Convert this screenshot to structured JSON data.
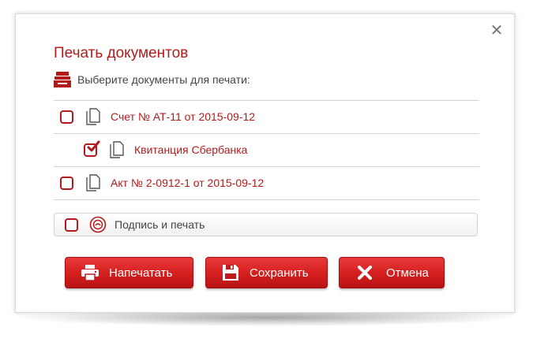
{
  "dialog": {
    "title": "Печать документов",
    "subtitle": "Выберите документы для печати:",
    "close_icon": "close-icon"
  },
  "documents": [
    {
      "label": "Счет № АТ-11 от 2015-09-12",
      "checked": false,
      "indented": false
    },
    {
      "label": "Квитанция Сбербанка",
      "checked": true,
      "indented": true
    },
    {
      "label": "Акт № 2-0912-1 от 2015-09-12",
      "checked": false,
      "indented": false
    }
  ],
  "signature": {
    "label": "Подпись и печать",
    "checked": false
  },
  "buttons": {
    "print": "Напечатать",
    "save": "Сохранить",
    "cancel": "Отмена"
  },
  "colors": {
    "accent": "#b31b1b",
    "button": "#d41e1e"
  }
}
